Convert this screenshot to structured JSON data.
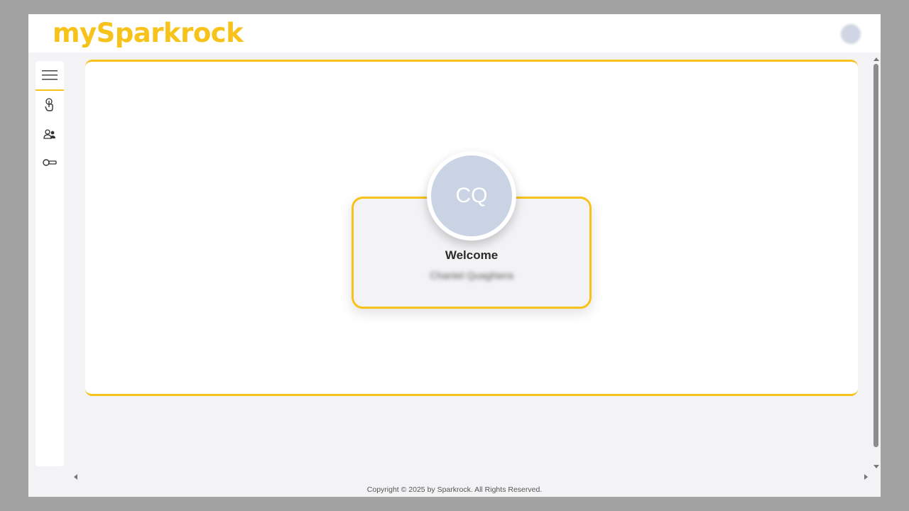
{
  "header": {
    "logo_text": "mySparkrock",
    "user_avatar_icon": "user-avatar-icon"
  },
  "sidebar": {
    "menu_icon": "hamburger-menu-icon",
    "items": [
      {
        "icon": "touch-hand-icon"
      },
      {
        "icon": "people-icon"
      },
      {
        "icon": "key-icon"
      }
    ]
  },
  "welcome": {
    "initials": "CQ",
    "title": "Welcome",
    "user_name": "Chantel Quaghiera"
  },
  "footer": {
    "copyright": "Copyright © 2025 by Sparkrock. All Rights Reserved."
  },
  "colors": {
    "accent": "#f7c21a",
    "avatar_bg": "#c9d3e4",
    "page_bg": "#f3f3f5"
  }
}
